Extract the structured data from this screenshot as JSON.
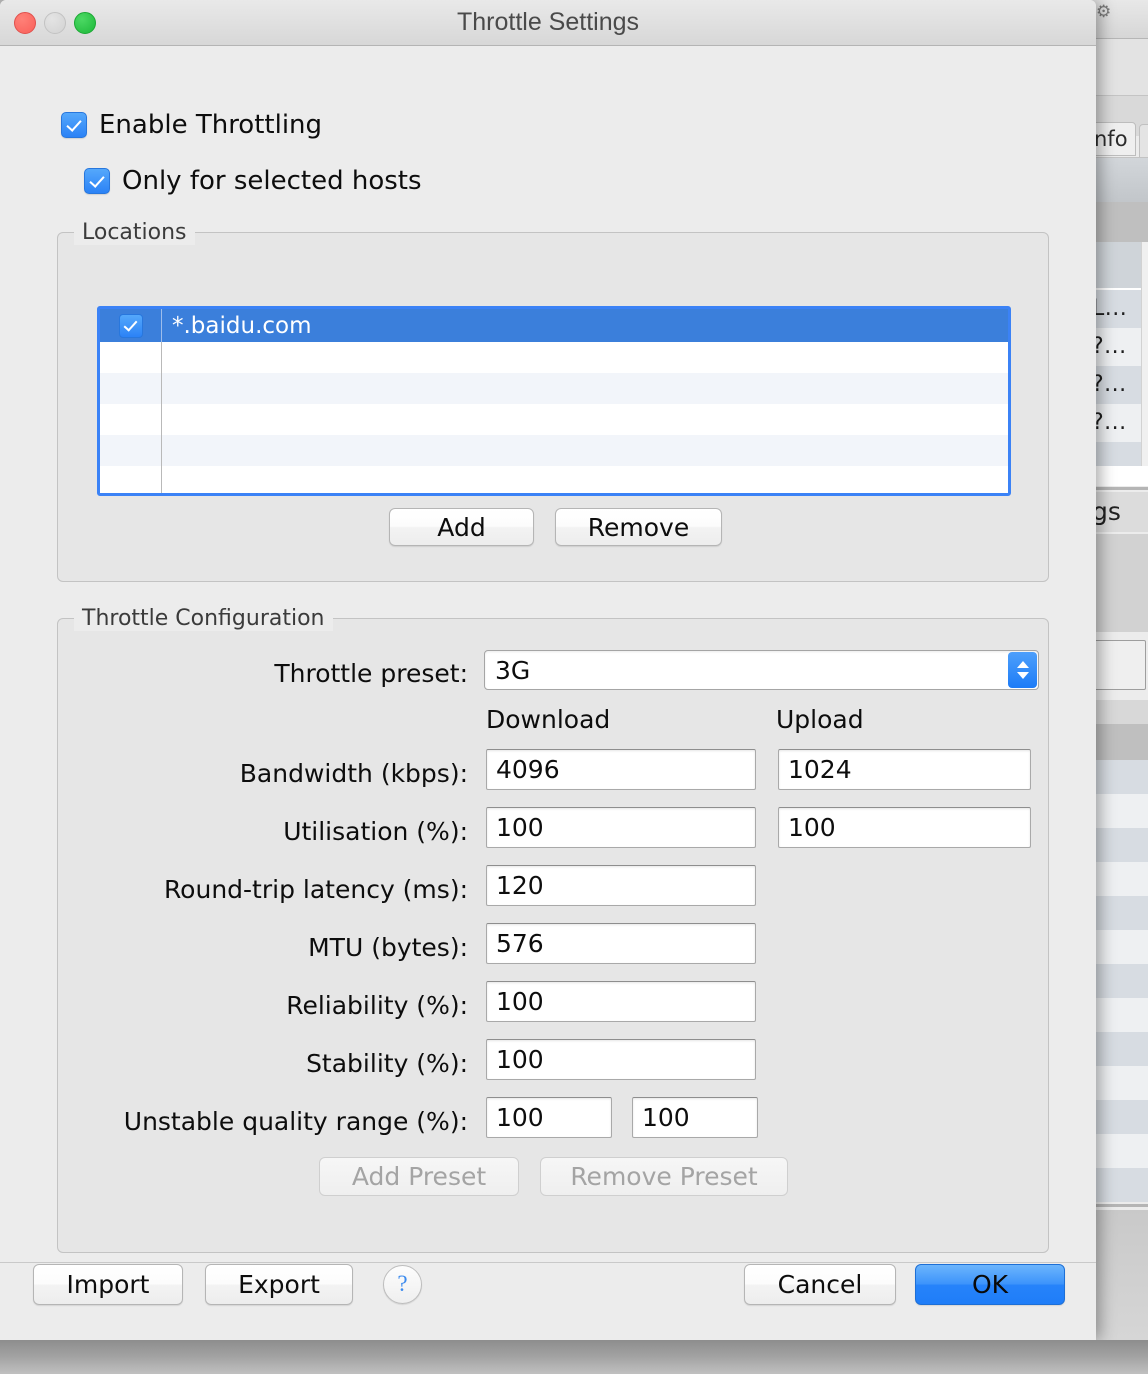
{
  "window": {
    "title": "Throttle Settings",
    "traffic_lights": [
      "close",
      "minimize",
      "maximize"
    ]
  },
  "options": {
    "enable_throttling": {
      "label": "Enable Throttling",
      "checked": true
    },
    "only_selected_hosts": {
      "label": "Only for selected hosts",
      "checked": true
    }
  },
  "locations": {
    "group_label": "Locations",
    "rows": [
      {
        "checked": true,
        "host": "*.baidu.com",
        "selected": true
      },
      {
        "checked": false,
        "host": "",
        "selected": false
      },
      {
        "checked": false,
        "host": "",
        "selected": false
      },
      {
        "checked": false,
        "host": "",
        "selected": false
      },
      {
        "checked": false,
        "host": "",
        "selected": false
      },
      {
        "checked": false,
        "host": "",
        "selected": false
      }
    ],
    "add_label": "Add",
    "remove_label": "Remove"
  },
  "throttle_config": {
    "group_label": "Throttle Configuration",
    "preset_label": "Throttle preset:",
    "preset_value": "3G",
    "column_headers": {
      "download": "Download",
      "upload": "Upload"
    },
    "fields": [
      {
        "label": "Bandwidth (kbps):",
        "download": "4096",
        "upload": "1024"
      },
      {
        "label": "Utilisation (%):",
        "download": "100",
        "upload": "100"
      },
      {
        "label": "Round-trip latency (ms):",
        "download": "120",
        "upload": null
      },
      {
        "label": "MTU (bytes):",
        "download": "576",
        "upload": null
      },
      {
        "label": "Reliability (%):",
        "download": "100",
        "upload": null
      },
      {
        "label": "Stability (%):",
        "download": "100",
        "upload": null
      }
    ],
    "unstable_range": {
      "label": "Unstable quality range (%):",
      "min": "100",
      "max": "100"
    },
    "add_preset_label": "Add Preset",
    "remove_preset_label": "Remove Preset",
    "add_preset_enabled": false,
    "remove_preset_enabled": false
  },
  "footer": {
    "import_label": "Import",
    "export_label": "Export",
    "help_label": "?",
    "cancel_label": "Cancel",
    "ok_label": "OK"
  },
  "background_window": {
    "tab_label": "nfo",
    "row_fragments": [
      "L...",
      "?...",
      "?...",
      "?..."
    ],
    "section_label": "gs"
  },
  "colors": {
    "accent_blue": "#3b82f6",
    "selection_blue": "#3b7fdb",
    "window_bg": "#ececec",
    "group_bg": "#e6e6e6"
  }
}
